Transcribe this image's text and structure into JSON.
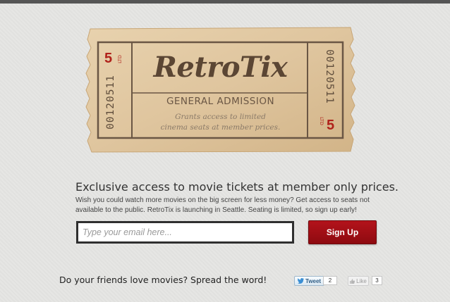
{
  "ticket": {
    "brand": "RetroTix",
    "admission": "GENERAL ADMISSION",
    "grants_line1": "Grants access to limited",
    "grants_line2": "cinema seats at member prices.",
    "serial": "00120511",
    "stub_number": "5",
    "stub_ltd": "LTD",
    "colors": {
      "paper": "#e1c8a2",
      "ink": "#5b4634",
      "accent_red": "#b0221b"
    }
  },
  "main": {
    "headline": "Exclusive access to movie tickets at member only prices.",
    "description": "Wish you could watch more movies on the big screen for less money? Get access to seats not available to the public. RetroTix is launching in Seattle. Seating is limited, so sign up early!",
    "email_placeholder": "Type your email here...",
    "signup_label": "Sign Up",
    "signup_color": "#a3111a"
  },
  "social": {
    "prompt": "Do your friends love movies? Spread the word!",
    "tweet_label": "Tweet",
    "tweet_count": "2",
    "like_label": "Like",
    "like_count": "3",
    "icons": [
      "twitter-bird-icon",
      "thumbs-up-icon"
    ]
  }
}
